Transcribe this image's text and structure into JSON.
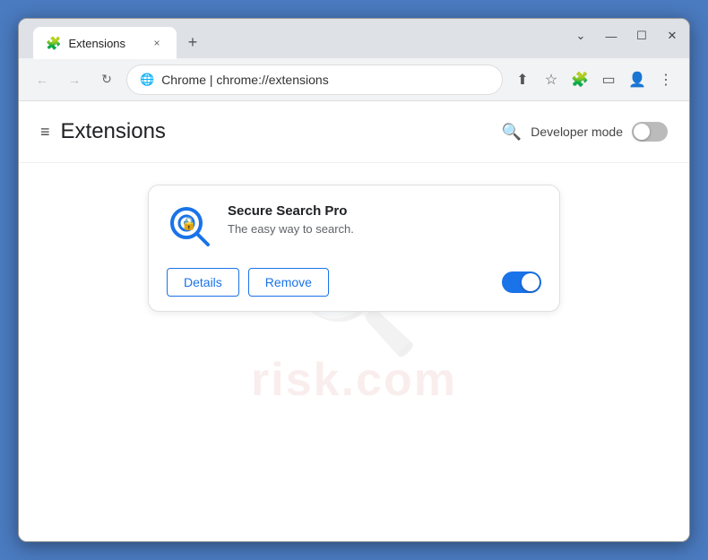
{
  "browser": {
    "tab": {
      "favicon": "🧩",
      "title": "Extensions",
      "close_icon": "×"
    },
    "new_tab_icon": "+",
    "window_controls": {
      "minimize": "—",
      "maximize": "☐",
      "close": "✕",
      "chevron": "⌄"
    },
    "address_bar": {
      "back_icon": "←",
      "forward_icon": "→",
      "reload_icon": "↻",
      "site_icon": "🌐",
      "url_brand": "Chrome",
      "url_path": "chrome://extensions",
      "url_separator": "|",
      "share_icon": "⬆",
      "bookmark_icon": "☆",
      "extensions_icon": "🧩",
      "sidebar_icon": "▭",
      "profile_icon": "👤",
      "menu_icon": "⋮"
    }
  },
  "page": {
    "header": {
      "hamburger_icon": "≡",
      "title": "Extensions",
      "search_icon": "🔍",
      "dev_mode_label": "Developer mode"
    },
    "extension": {
      "name": "Secure Search Pro",
      "description": "The easy way to search.",
      "details_btn": "Details",
      "remove_btn": "Remove",
      "enabled": true
    },
    "watermark": {
      "text": "risk.com"
    }
  }
}
